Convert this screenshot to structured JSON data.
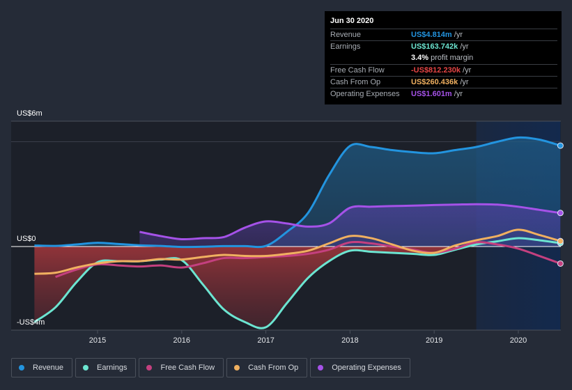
{
  "tooltip": {
    "date": "Jun 30 2020",
    "rows": [
      {
        "label": "Revenue",
        "value": "US$4.814m",
        "unit": " /yr",
        "color": "#2394df"
      },
      {
        "label": "Earnings",
        "value": "US$163.742k",
        "unit": " /yr",
        "color": "#6ce5d1"
      },
      {
        "label": "",
        "value": "3.4%",
        "unit": " profit margin",
        "color": "#ffffff"
      },
      {
        "label": "Free Cash Flow",
        "value": "-US$812.230k",
        "unit": " /yr",
        "color": "#e64545"
      },
      {
        "label": "Cash From Op",
        "value": "US$260.436k",
        "unit": " /yr",
        "color": "#f0b060"
      },
      {
        "label": "Operating Expenses",
        "value": "US$1.601m",
        "unit": " /yr",
        "color": "#a552e8"
      }
    ]
  },
  "legend": [
    {
      "label": "Revenue",
      "color": "#2394df"
    },
    {
      "label": "Earnings",
      "color": "#6ce5d1"
    },
    {
      "label": "Free Cash Flow",
      "color": "#c4407f"
    },
    {
      "label": "Cash From Op",
      "color": "#f0b060"
    },
    {
      "label": "Operating Expenses",
      "color": "#a552e8"
    }
  ],
  "chart_data": {
    "type": "line",
    "title": "",
    "xlabel": "",
    "ylabel": "",
    "x_ticks": [
      "2015",
      "2016",
      "2017",
      "2018",
      "2019",
      "2020"
    ],
    "y_tick_labels": [
      "US$6m",
      "US$0",
      "-US$4m"
    ],
    "ylim": [
      -4,
      6
    ],
    "xlim": [
      2014.25,
      2020.5
    ],
    "units": "US$ millions",
    "highlight_region": [
      2019.5,
      2020.5
    ],
    "series": [
      {
        "name": "Revenue",
        "color": "#2394df",
        "x": [
          2014.25,
          2014.5,
          2014.75,
          2015.0,
          2015.25,
          2015.5,
          2015.75,
          2016.0,
          2016.25,
          2016.5,
          2016.75,
          2017.0,
          2017.25,
          2017.5,
          2017.75,
          2018.0,
          2018.25,
          2018.5,
          2018.75,
          2019.0,
          2019.25,
          2019.5,
          2019.75,
          2020.0,
          2020.25,
          2020.5
        ],
        "y": [
          0.05,
          0.03,
          0.1,
          0.18,
          0.12,
          0.06,
          0.03,
          -0.02,
          -0.01,
          0.02,
          0.02,
          0.03,
          0.7,
          1.6,
          3.4,
          4.8,
          4.75,
          4.6,
          4.5,
          4.45,
          4.6,
          4.75,
          5.0,
          5.2,
          5.1,
          4.814
        ]
      },
      {
        "name": "Earnings",
        "color": "#6ce5d1",
        "x": [
          2014.25,
          2014.5,
          2014.75,
          2015.0,
          2015.25,
          2015.5,
          2015.75,
          2016.0,
          2016.25,
          2016.5,
          2016.75,
          2017.0,
          2017.25,
          2017.5,
          2017.75,
          2018.0,
          2018.25,
          2018.5,
          2018.75,
          2019.0,
          2019.25,
          2019.5,
          2019.75,
          2020.0,
          2020.25,
          2020.5
        ],
        "y": [
          -3.6,
          -2.9,
          -1.7,
          -0.75,
          -0.7,
          -0.7,
          -0.62,
          -0.65,
          -1.8,
          -3.0,
          -3.6,
          -3.85,
          -2.7,
          -1.5,
          -0.7,
          -0.2,
          -0.25,
          -0.3,
          -0.35,
          -0.4,
          -0.15,
          0.1,
          0.25,
          0.4,
          0.3,
          0.164
        ]
      },
      {
        "name": "Free Cash Flow",
        "color": "#c4407f",
        "x": [
          2014.5,
          2014.75,
          2015.0,
          2015.25,
          2015.5,
          2015.75,
          2016.0,
          2016.25,
          2016.5,
          2016.75,
          2017.0,
          2017.25,
          2017.5,
          2017.75,
          2018.0,
          2018.25,
          2018.5,
          2018.75,
          2019.0,
          2019.25,
          2019.5,
          2019.75,
          2020.0,
          2020.25,
          2020.5
        ],
        "y": [
          -1.45,
          -1.1,
          -0.85,
          -0.9,
          -0.95,
          -0.9,
          -1.0,
          -0.8,
          -0.55,
          -0.55,
          -0.5,
          -0.45,
          -0.35,
          -0.15,
          0.2,
          0.15,
          0.0,
          -0.15,
          -0.3,
          -0.1,
          0.2,
          0.1,
          -0.1,
          -0.45,
          -0.812
        ]
      },
      {
        "name": "Cash From Op",
        "color": "#f0b060",
        "x": [
          2014.25,
          2014.5,
          2014.75,
          2015.0,
          2015.25,
          2015.5,
          2015.75,
          2016.0,
          2016.25,
          2016.5,
          2016.75,
          2017.0,
          2017.25,
          2017.5,
          2017.75,
          2018.0,
          2018.25,
          2018.5,
          2018.75,
          2019.0,
          2019.25,
          2019.5,
          2019.75,
          2020.0,
          2020.25,
          2020.5
        ],
        "y": [
          -1.3,
          -1.25,
          -1.0,
          -0.8,
          -0.7,
          -0.7,
          -0.6,
          -0.62,
          -0.5,
          -0.4,
          -0.45,
          -0.45,
          -0.35,
          -0.2,
          0.15,
          0.5,
          0.4,
          0.1,
          -0.2,
          -0.3,
          0.05,
          0.3,
          0.5,
          0.8,
          0.55,
          0.26
        ]
      },
      {
        "name": "Operating Expenses",
        "color": "#a552e8",
        "x": [
          2015.5,
          2015.75,
          2016.0,
          2016.25,
          2016.5,
          2016.75,
          2017.0,
          2017.25,
          2017.5,
          2017.75,
          2018.0,
          2018.25,
          2018.5,
          2018.75,
          2019.0,
          2019.25,
          2019.5,
          2019.75,
          2020.0,
          2020.25,
          2020.5
        ],
        "y": [
          0.7,
          0.5,
          0.35,
          0.4,
          0.45,
          0.9,
          1.2,
          1.1,
          0.95,
          1.1,
          1.85,
          1.9,
          1.93,
          1.95,
          1.98,
          2.0,
          2.02,
          2.0,
          1.9,
          1.75,
          1.601
        ]
      }
    ]
  }
}
